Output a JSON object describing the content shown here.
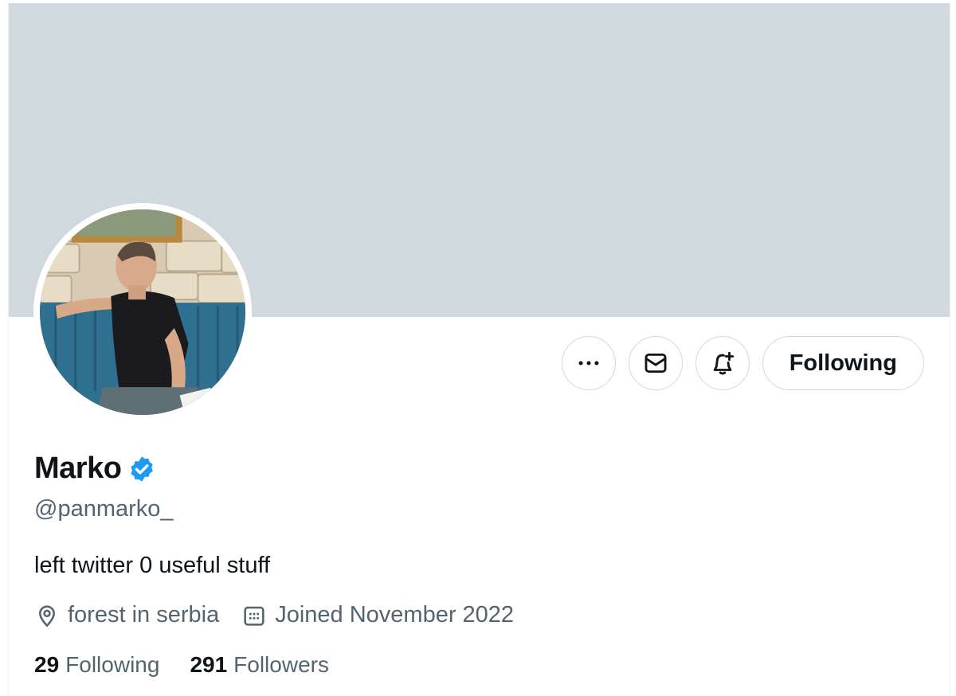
{
  "profile": {
    "name": "Marko",
    "handle": "@panmarko_",
    "bio": "left twitter 0 useful stuff",
    "location": "forest in serbia",
    "joined": "Joined November 2022",
    "verified": true,
    "avatar_icon": "profile-photo",
    "banner_color": "#cfd9de"
  },
  "actions": {
    "more_icon": "more-horizontal-icon",
    "message_icon": "envelope-icon",
    "notify_icon": "bell-plus-icon",
    "follow_label": "Following"
  },
  "stats": {
    "following_count": "29",
    "following_label": "Following",
    "followers_count": "291",
    "followers_label": "Followers"
  },
  "colors": {
    "verified_blue": "#1d9bf0",
    "secondary_text": "#536471",
    "primary_text": "#0f1419",
    "border": "#cfd9de"
  }
}
